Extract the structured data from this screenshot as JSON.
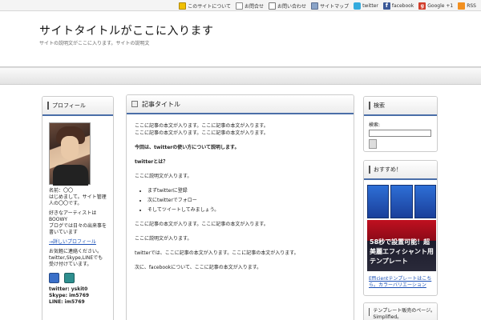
{
  "topnav": {
    "items": [
      {
        "label": "このサイトについて",
        "icon": "pencil-icon"
      },
      {
        "label": "お問合せ",
        "icon": "list-icon"
      },
      {
        "label": "お問い合わせ",
        "icon": "mail-icon"
      },
      {
        "label": "サイトマップ",
        "icon": "sitemap-icon"
      },
      {
        "label": "twitter",
        "icon": "twitter-icon"
      },
      {
        "label": "facebook",
        "icon": "facebook-icon"
      },
      {
        "label": "Google +1",
        "icon": "google-plus-icon"
      },
      {
        "label": "RSS",
        "icon": "rss-icon"
      }
    ]
  },
  "header": {
    "title": "サイトタイトルがここに入ります",
    "description": "サイトの説明文がここに入ります。サイトの説明文"
  },
  "left": {
    "heading": "プロフィール",
    "name": "名前：〇〇",
    "intro1": "はじめまして。サイト管理人の〇〇です。",
    "intro2": "好きなアーティストはBOOWY",
    "intro3": "ブログでは日々の出来事を書いています",
    "more_link": "→詳しいプロフィール",
    "contact": "お気軽に連絡ください。twitter,Skype,LINEでも受け付けています。",
    "twitter": "twitter: yskit0",
    "skype": "Skype: im5769",
    "line": "LINE: im5769"
  },
  "main": {
    "title": "記事タイトル",
    "p1": "ここに記事の本文が入ります。ここに記事の本文が入ります。",
    "p2": "ここに記事の本文が入ります。ここに記事の本文が入ります。",
    "p3": "今回は、twitterの使い方について説明します。",
    "p4": "twitterとは？",
    "p5": "ここに説明文が入ります。",
    "bullets": [
      "まずtwitterに登録",
      "次にtwitterでフォロー",
      "そしてツイートしてみましょう。"
    ],
    "p6": "ここに記事の本文が入ります。ここに記事の本文が入ります。",
    "p7": "ここに説明文が入ります。",
    "p8": "twitterでは、ここに記事の本文が入ります。ここに記事の本文が入ります。",
    "p9": "次に、facebookについて、ここに記事の本文が入ります。"
  },
  "right": {
    "search_heading": "検索",
    "search_label": "検索:",
    "promo_heading": "おすすめ！",
    "promo_banner": "58秒で設置可能！超美麗エフィシャント用テンプレート",
    "promo_text": "Efficientテンプレートはこちら。カラーバリエーション",
    "box3_heading": "テンプレート販売のページ。Simplified。"
  }
}
